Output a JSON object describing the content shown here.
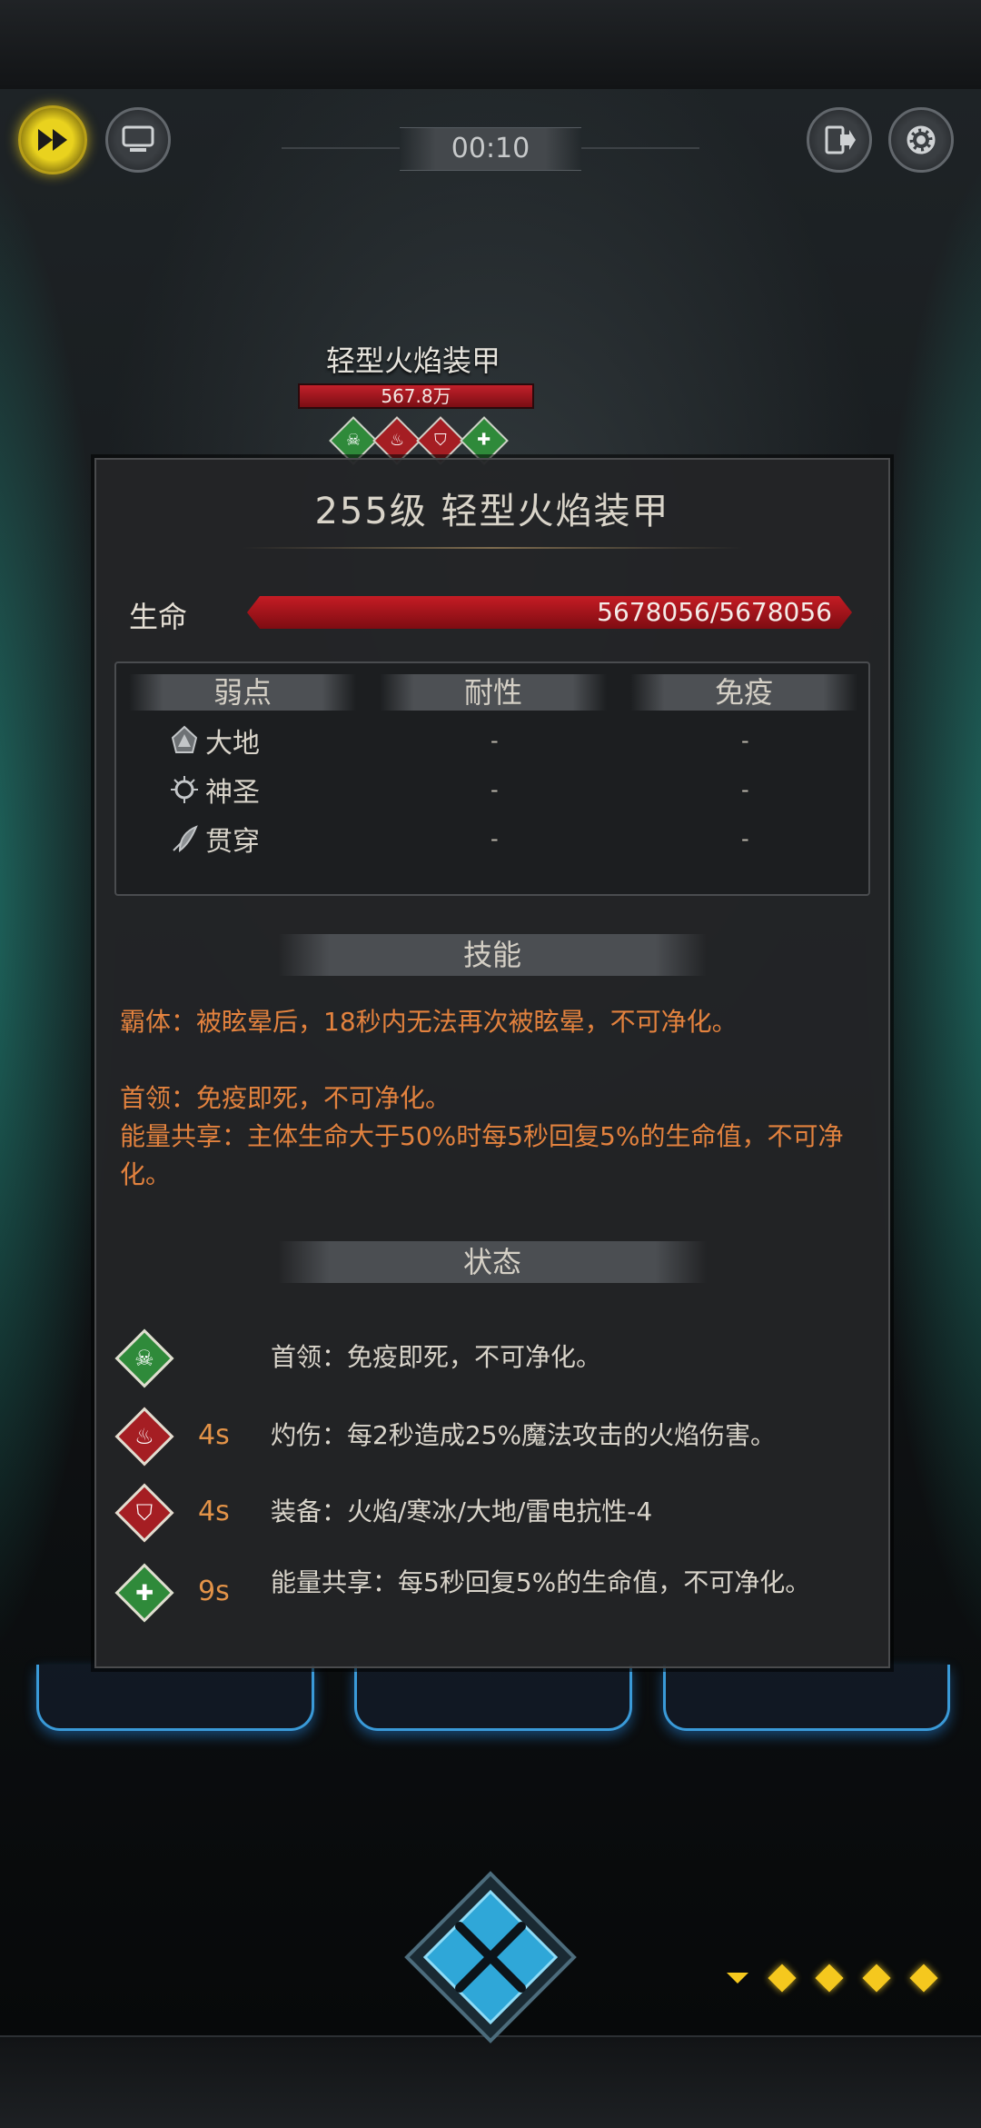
{
  "hud": {
    "timer": "00:10",
    "buttons": [
      "fast-forward",
      "auto-battle",
      "exit",
      "settings"
    ]
  },
  "boss": {
    "name": "轻型火焰装甲",
    "hp_short": "567.8万",
    "hp_fraction": 1.0
  },
  "panel": {
    "title": "255级  轻型火焰装甲",
    "hp_label": "生命",
    "hp_text": "5678056/5678056",
    "resist_headers": [
      "弱点",
      "耐性",
      "免疫"
    ],
    "resist_rows": [
      {
        "icon": "earth-icon",
        "name": "大地",
        "resist": "-",
        "immune": "-"
      },
      {
        "icon": "holy-icon",
        "name": "神圣",
        "resist": "-",
        "immune": "-"
      },
      {
        "icon": "pierce-icon",
        "name": "贯穿",
        "resist": "-",
        "immune": "-"
      }
    ],
    "skills_header": "技能",
    "skills": [
      "霸体：被眩晕后，18秒内无法再次被眩晕，不可净化。",
      "首领：免疫即死，不可净化。",
      "能量共享：主体生命大于50%时每5秒回复5%的生命值，不可净化。"
    ],
    "status_header": "状态",
    "statuses": [
      {
        "icon": "skull-icon",
        "color": "#2f8a3a",
        "glyph": "☠",
        "time": "",
        "text": "首领：免疫即死，不可净化。"
      },
      {
        "icon": "flame-icon",
        "color": "#a51e23",
        "glyph": "🔥",
        "time": "4s",
        "text": "灼伤：每2秒造成25%魔法攻击的火焰伤害。"
      },
      {
        "icon": "shield-icon",
        "color": "#a51e23",
        "glyph": "⛉",
        "time": "4s",
        "text": "装备：火焰/寒冰/大地/雷电抗性-4"
      },
      {
        "icon": "heal-plus-icon",
        "color": "#2f8a3a",
        "glyph": "✚",
        "time": "9s",
        "text": "能量共享：每5秒回复5%的生命值，不可净化。"
      }
    ]
  },
  "colors": {
    "accent_gold": "#f5c81e",
    "hp_red": "#c51c24",
    "skill_orange": "#e3823e",
    "buff_green": "#2f8a3a",
    "debuff_red": "#a51e23"
  },
  "pager": {
    "total": 4,
    "current": 1
  }
}
